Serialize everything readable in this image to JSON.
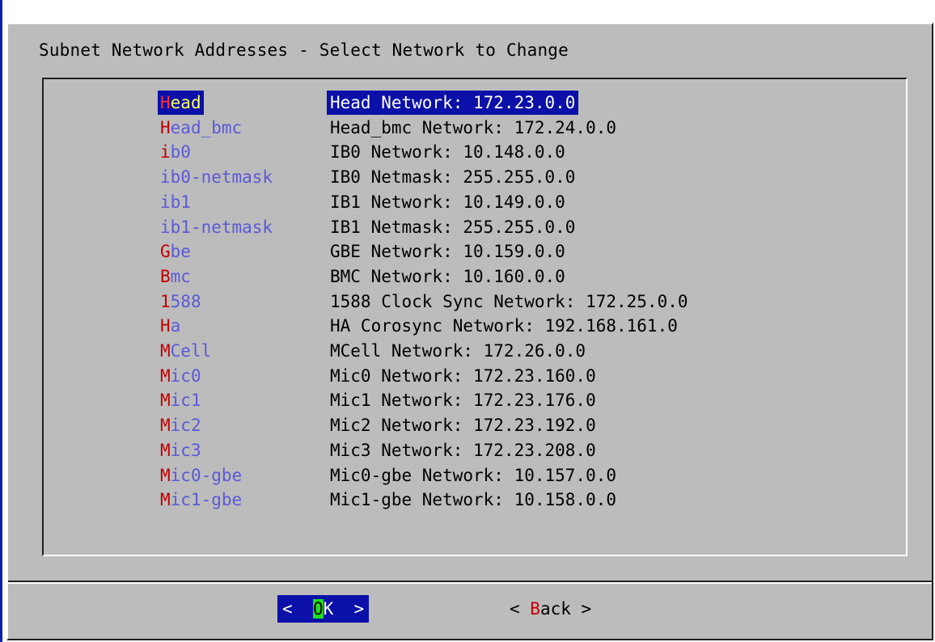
{
  "dialog": {
    "title": "Subnet Network Addresses - Select Network to Change"
  },
  "menu": {
    "items": [
      {
        "tag_hot": "H",
        "tag_rest": "ead",
        "desc": "Head Network: 172.23.0.0",
        "selected": true
      },
      {
        "tag_hot": "H",
        "tag_rest": "ead_bmc",
        "desc": "Head_bmc Network: 172.24.0.0"
      },
      {
        "tag_hot": "i",
        "tag_rest": "b0",
        "desc": "IB0 Network: 10.148.0.0"
      },
      {
        "tag_hot": "",
        "tag_rest": "ib0-netmask",
        "desc": "IB0 Netmask: 255.255.0.0"
      },
      {
        "tag_hot": "",
        "tag_rest": "ib1",
        "desc": "IB1 Network: 10.149.0.0"
      },
      {
        "tag_hot": "",
        "tag_rest": "ib1-netmask",
        "desc": "IB1 Netmask: 255.255.0.0"
      },
      {
        "tag_hot": "G",
        "tag_rest": "be",
        "desc": "GBE Network: 10.159.0.0"
      },
      {
        "tag_hot": "B",
        "tag_rest": "mc",
        "desc": "BMC Network: 10.160.0.0"
      },
      {
        "tag_hot": "1",
        "tag_rest": "588",
        "desc": "1588 Clock Sync Network: 172.25.0.0"
      },
      {
        "tag_hot": "H",
        "tag_rest": "a",
        "desc": "HA Corosync Network: 192.168.161.0"
      },
      {
        "tag_hot": "M",
        "tag_rest": "Cell",
        "desc": "MCell Network: 172.26.0.0"
      },
      {
        "tag_hot": "M",
        "tag_rest": "ic0",
        "desc": "Mic0 Network: 172.23.160.0"
      },
      {
        "tag_hot": "M",
        "tag_rest": "ic1",
        "desc": "Mic1 Network: 172.23.176.0"
      },
      {
        "tag_hot": "M",
        "tag_rest": "ic2",
        "desc": "Mic2 Network: 172.23.192.0"
      },
      {
        "tag_hot": "M",
        "tag_rest": "ic3",
        "desc": "Mic3 Network: 172.23.208.0"
      },
      {
        "tag_hot": "M",
        "tag_rest": "ic0-gbe",
        "desc": "Mic0-gbe Network: 10.157.0.0"
      },
      {
        "tag_hot": "M",
        "tag_rest": "ic1-gbe",
        "desc": "Mic1-gbe Network: 10.158.0.0"
      }
    ]
  },
  "buttons": {
    "ok": {
      "left": "<  ",
      "hot": "O",
      "rest": "K  >"
    },
    "back": {
      "left": "< ",
      "hot": "B",
      "rest": "ack >"
    }
  },
  "colors": {
    "background": "#bcbcbc",
    "selection": "#0a10a8",
    "hotkey": "#c00000",
    "tag_text": "#5a5ad6",
    "ok_hotkey_bg": "#22dd22"
  }
}
